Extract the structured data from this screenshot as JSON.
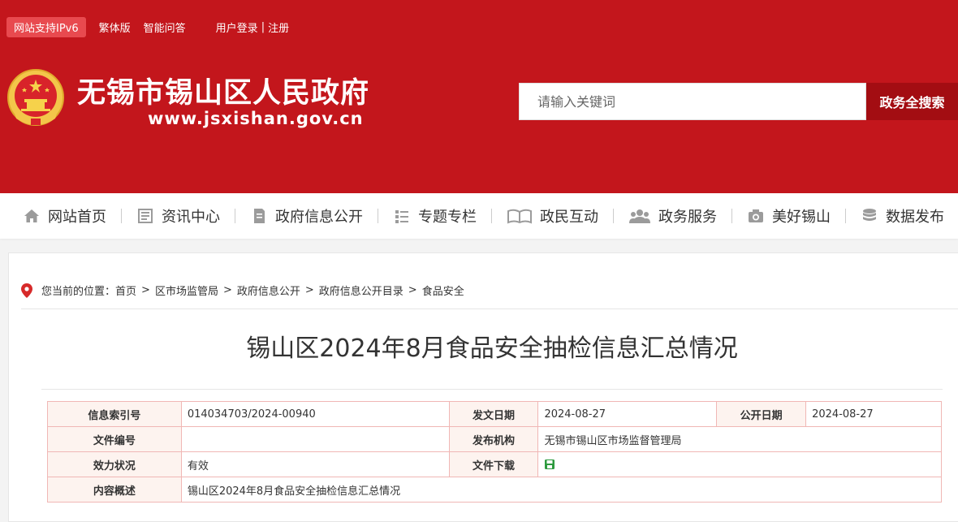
{
  "topbar": {
    "ipv6": "网站支持IPv6",
    "traditional": "繁体版",
    "qa": "智能问答",
    "login": "用户登录",
    "separator": "|",
    "register": "注册"
  },
  "site": {
    "title": "无锡市锡山区人民政府",
    "url": "www.jsxishan.gov.cn"
  },
  "search": {
    "placeholder": "请输入关键词",
    "button": "政务全搜索"
  },
  "nav": [
    {
      "label": "网站首页",
      "icon": "home-icon"
    },
    {
      "label": "资讯中心",
      "icon": "news-icon"
    },
    {
      "label": "政府信息公开",
      "icon": "document-icon"
    },
    {
      "label": "专题专栏",
      "icon": "list-icon"
    },
    {
      "label": "政民互动",
      "icon": "book-icon"
    },
    {
      "label": "政务服务",
      "icon": "people-icon"
    },
    {
      "label": "美好锡山",
      "icon": "camera-icon"
    },
    {
      "label": "数据发布",
      "icon": "database-icon"
    }
  ],
  "breadcrumb": {
    "prefix": "您当前的位置：",
    "items": [
      "首页",
      "区市场监管局",
      "政府信息公开",
      "政府信息公开目录",
      "食品安全"
    ],
    "sep": ">"
  },
  "article": {
    "title": "锡山区2024年8月食品安全抽检信息汇总情况"
  },
  "meta": {
    "index_label": "信息索引号",
    "index_value": "014034703/2024-00940",
    "issue_date_label": "发文日期",
    "issue_date_value": "2024-08-27",
    "public_date_label": "公开日期",
    "public_date_value": "2024-08-27",
    "doc_no_label": "文件编号",
    "doc_no_value": "",
    "publisher_label": "发布机构",
    "publisher_value": "无锡市锡山区市场监督管理局",
    "validity_label": "效力状况",
    "validity_value": "有效",
    "download_label": "文件下载",
    "download_icon": "save-icon",
    "summary_label": "内容概述",
    "summary_value": "锡山区2024年8月食品安全抽检信息汇总情况"
  },
  "colors": {
    "header_red": "#c3161c",
    "search_button": "#a30d12",
    "table_border": "#f0b7b5",
    "label_bg": "#fdf3ef"
  }
}
